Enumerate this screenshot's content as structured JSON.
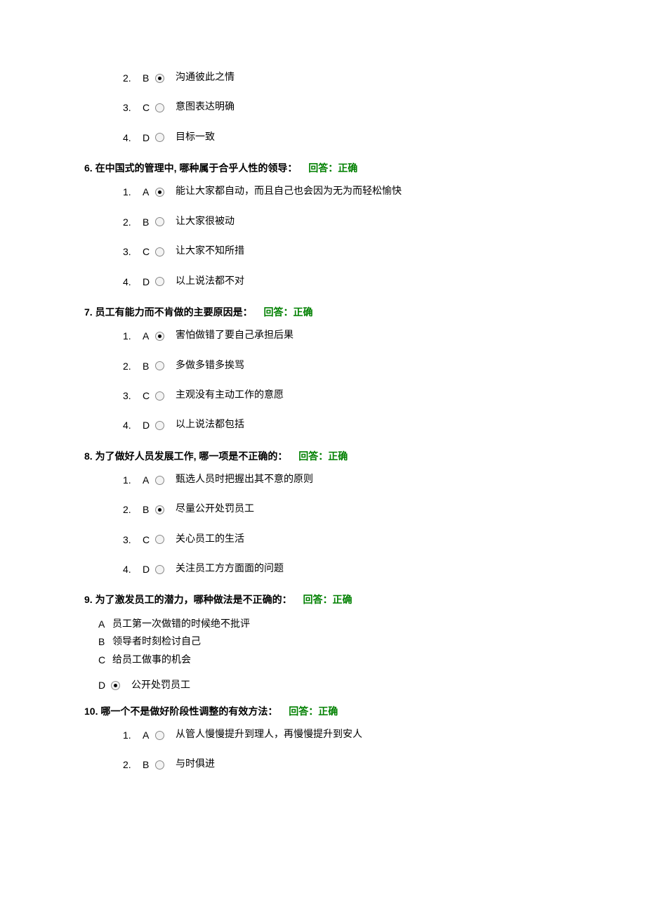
{
  "partial_q5": {
    "options": [
      {
        "num": "2.",
        "letter": "B",
        "selected": true,
        "text": "沟通彼此之情"
      },
      {
        "num": "3.",
        "letter": "C",
        "selected": false,
        "text": "意图表达明确"
      },
      {
        "num": "4.",
        "letter": "D",
        "selected": false,
        "text": "目标一致"
      }
    ]
  },
  "questions": [
    {
      "num": "6.",
      "text": "在中国式的管理中, 哪种属于合乎人性的领导：",
      "feedback": "回答：正确",
      "options": [
        {
          "num": "1.",
          "letter": "A",
          "selected": true,
          "text": "能让大家都自动，而且自己也会因为无为而轻松愉快"
        },
        {
          "num": "2.",
          "letter": "B",
          "selected": false,
          "text": "让大家很被动"
        },
        {
          "num": "3.",
          "letter": "C",
          "selected": false,
          "text": "让大家不知所措"
        },
        {
          "num": "4.",
          "letter": "D",
          "selected": false,
          "text": "以上说法都不对"
        }
      ]
    },
    {
      "num": "7.",
      "text": "员工有能力而不肯做的主要原因是：",
      "feedback": "回答：正确",
      "options": [
        {
          "num": "1.",
          "letter": "A",
          "selected": true,
          "text": "害怕做错了要自己承担后果"
        },
        {
          "num": "2.",
          "letter": "B",
          "selected": false,
          "text": "多做多错多挨骂"
        },
        {
          "num": "3.",
          "letter": "C",
          "selected": false,
          "text": "主观没有主动工作的意愿"
        },
        {
          "num": "4.",
          "letter": "D",
          "selected": false,
          "text": "以上说法都包括"
        }
      ]
    },
    {
      "num": "8.",
      "text": "为了做好人员发展工作, 哪一项是不正确的：",
      "feedback": "回答：正确",
      "options": [
        {
          "num": "1.",
          "letter": "A",
          "selected": false,
          "text": "甄选人员时把握出其不意的原则"
        },
        {
          "num": "2.",
          "letter": "B",
          "selected": true,
          "text": "尽量公开处罚员工"
        },
        {
          "num": "3.",
          "letter": "C",
          "selected": false,
          "text": "关心员工的生活"
        },
        {
          "num": "4.",
          "letter": "D",
          "selected": false,
          "text": "关注员工方方面面的问题"
        }
      ]
    }
  ],
  "q9": {
    "num": "9.",
    "text": "为了激发员工的潜力，哪种做法是不正确的：",
    "feedback": "回答：正确",
    "simple": [
      {
        "letter": "A",
        "text": "员工第一次做错的时候绝不批评"
      },
      {
        "letter": "B",
        "text": "领导者时刻检讨自己"
      },
      {
        "letter": "C",
        "text": "给员工做事的机会"
      }
    ],
    "radio_option": {
      "letter": "D",
      "selected": true,
      "text": "公开处罚员工"
    }
  },
  "q10": {
    "num": "10.",
    "text": "哪一个不是做好阶段性调整的有效方法：",
    "feedback": "回答：正确",
    "options": [
      {
        "num": "1.",
        "letter": "A",
        "selected": false,
        "text": "从管人慢慢提升到理人，再慢慢提升到安人"
      },
      {
        "num": "2.",
        "letter": "B",
        "selected": false,
        "text": "与时俱进"
      }
    ]
  }
}
